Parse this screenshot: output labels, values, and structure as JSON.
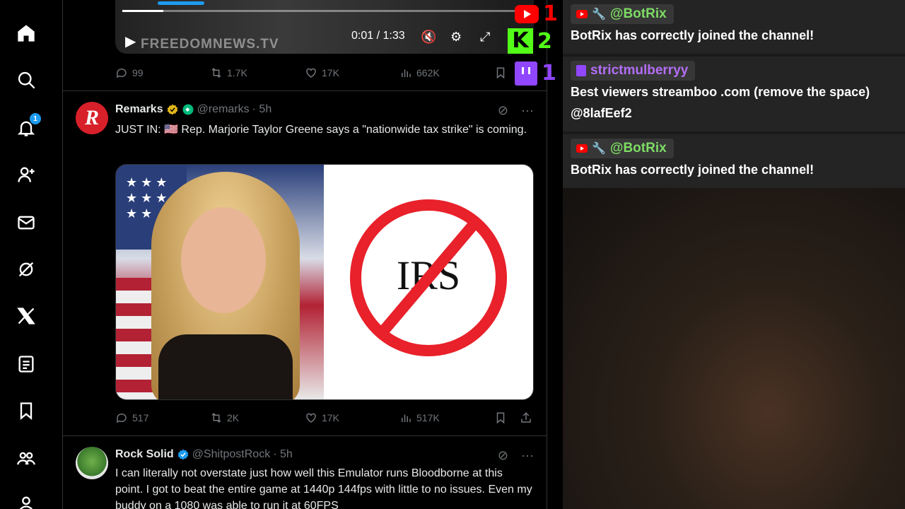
{
  "nav": {
    "notification_count": "1",
    "icons": [
      "home-icon",
      "search-icon",
      "bell-icon",
      "add-user-icon",
      "mail-icon",
      "grok-icon",
      "x-logo-icon",
      "lists-icon",
      "bookmark-icon",
      "communities-icon",
      "profile-icon"
    ]
  },
  "video_post": {
    "watermark": "FREEDOMNEWS.TV",
    "time": "0:01 / 1:33",
    "replies": "99",
    "reposts": "1.7K",
    "likes": "17K",
    "views": "662K"
  },
  "tweet1": {
    "name": "Remarks",
    "handle": "@remarks",
    "time": "· 5h",
    "text": "JUST IN: 🇺🇸 Rep. Marjorie Taylor Greene says a \"nationwide tax strike\" is coming.",
    "image_text": "IRS",
    "replies": "517",
    "reposts": "2K",
    "likes": "17K",
    "views": "517K"
  },
  "tweet2": {
    "name": "Rock Solid",
    "handle": "@ShitpostRock",
    "time": "· 5h",
    "text": "I can literally not overstate just how well this Emulator runs Bloodborne at this point. I got to beat the entire game at 1440p 144fps with little to no issues. Even my buddy on a 1080 was able to run it at 60FPS"
  },
  "platforms": {
    "youtube": "1",
    "kick": "2",
    "twitch": "1"
  },
  "chat": [
    {
      "platform": "youtube",
      "user": "@BotRix",
      "text": "BotRix has correctly joined the channel!",
      "color": "#7ddc64"
    },
    {
      "platform": "twitch",
      "user": "strictmulberryy",
      "text": "Best viewers streamboo .com (remove the space) @8lafEef2",
      "color": "#b36ef5"
    },
    {
      "platform": "youtube",
      "user": "@BotRix",
      "text": "BotRix has correctly joined the channel!",
      "color": "#7ddc64"
    }
  ],
  "colors": {
    "accent": "#1d9bf0",
    "youtube": "#ff0000",
    "kick": "#53fc18",
    "twitch": "#9146ff"
  }
}
